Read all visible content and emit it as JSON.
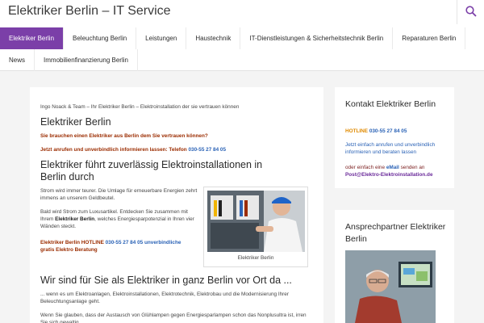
{
  "header": {
    "site_title": "Elektriker Berlin – IT Service",
    "search_icon": "search-icon"
  },
  "nav": {
    "row1": [
      {
        "label": "Elektriker Berlin",
        "active": true
      },
      {
        "label": "Beleuchtung Berlin",
        "active": false
      },
      {
        "label": "Leistungen",
        "active": false
      },
      {
        "label": "Haustechnik",
        "active": false
      },
      {
        "label": "IT-Dienstleistungen & Sicherheitstechnik Berlin",
        "active": false
      },
      {
        "label": "Reparaturen Berlin",
        "active": false
      }
    ],
    "row2": [
      {
        "label": "News",
        "active": false
      },
      {
        "label": "Immobilienfinanzierung Berlin",
        "active": false
      }
    ]
  },
  "main": {
    "breadcrumb": "Ingo Noack & Team – Ihr Elektriker Berlin – Elektroinstallation der sie vertrauen können",
    "h1": "Elektriker Berlin",
    "lead_red": "Sie brauchen einen Elektriker aus Berlin dem Sie vertrauen können?",
    "cta_text": "Jetzt anrufen und unverbindlich informieren lassen: Telefon ",
    "cta_phone": "030-55 27 84 05",
    "h2": "Elektriker führt zuverlässig Elektroinstallationen in Berlin durch",
    "p1": "Strom wird immer teurer. Die Umlage für erneuerbare Energien zehrt immens an unserem Geldbeutel.",
    "p2_a": "Bald wird Strom zum Luxusartikel. Entdecken Sie zusammen mit Ihrem ",
    "p2_b": "Elektriker Berlin",
    "p2_c": ", welches Energiesparpotenzial in Ihren vier Wänden steckt.",
    "hotline_a": "Elektriker Berlin HOTLINE ",
    "hotline_b": "030-55 27 84 05 unverbindliche",
    "hotline_c": "gratis Elektro Beratung",
    "figure_caption": "Elektriker Berlin",
    "h3": "Wir sind für Sie als Elektriker in ganz Berlin vor Ort da ...",
    "p3": "... wenn es um Elektroanlagen, Elektroinstallationen, Elektrotechnik, Elektrobau und die Modernisierung Ihrer Beleuchtungsanlage geht.",
    "p4": "Wenn Sie glauben, dass der Austausch von Glühlampen gegen Energiesparlampen schon das Nonplusultra ist, irren Sie sich gewaltig."
  },
  "sidebar": {
    "contact": {
      "title": "Kontakt Elektriker Berlin",
      "hotline_label": "HOTLINE ",
      "hotline_number": "030-55 27 84 05",
      "text": "Jetzt einfach anrufen und unverbindlich informieren und beraten lassen",
      "email_text_a": "oder einfach eine ",
      "email_text_b": "eMail",
      "email_text_c": " senden an",
      "email": "Post@Elektro-Elektroinstallation.de"
    },
    "person": {
      "title": "Ansprechpartner Elektriker Berlin"
    }
  },
  "colors": {
    "accent": "#7b3fa8",
    "link_blue": "#2a62b6",
    "warning_red": "#9b2c00"
  }
}
